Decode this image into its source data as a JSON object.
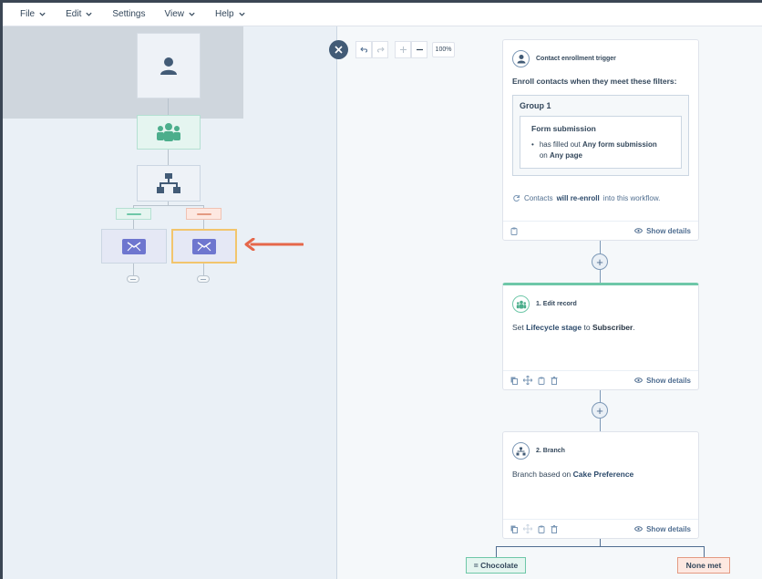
{
  "menu": {
    "items": [
      {
        "label": "File",
        "has_chevron": true
      },
      {
        "label": "Edit",
        "has_chevron": true
      },
      {
        "label": "Settings",
        "has_chevron": false
      },
      {
        "label": "View",
        "has_chevron": true
      },
      {
        "label": "Help",
        "has_chevron": true
      }
    ]
  },
  "toolbar": {
    "zoom_level": "100%",
    "undo_icon": "undo-icon",
    "redo_icon": "redo-icon",
    "zoom_in_icon": "plus-icon",
    "zoom_out_icon": "minus-icon"
  },
  "trigger_card": {
    "title": "Contact enrollment trigger",
    "heading": "Enroll contacts when they meet these filters:",
    "group_title": "Group 1",
    "filter_title": "Form submission",
    "filter_prefix": "has filled out",
    "filter_value": "Any form submission",
    "filter_on": "on",
    "filter_page": "Any page",
    "reenroll_prefix": "Contacts",
    "reenroll_bold": "will re-enroll",
    "reenroll_suffix": "into this workflow.",
    "show_details": "Show details"
  },
  "edit_card": {
    "title": "1. Edit record",
    "text_prefix": "Set",
    "property": "Lifecycle stage",
    "text_mid": "to",
    "value": "Subscriber",
    "text_end": ".",
    "show_details": "Show details",
    "accent": "#6ec7a8"
  },
  "branch_card": {
    "title": "2. Branch",
    "text_prefix": "Branch based on",
    "property": "Cake Preference",
    "show_details": "Show details"
  },
  "branches": [
    {
      "label": "= Chocolate",
      "color": "#e5f5f0",
      "border": "#6ec7a8"
    },
    {
      "label": "None met",
      "color": "#fde8e1",
      "border": "#e39a82"
    }
  ],
  "minimap": {
    "label_colors": [
      "#6ec7a8",
      "#e39a82"
    ],
    "selected_border": "#f2c56d",
    "arrow_color": "#e5674a"
  }
}
